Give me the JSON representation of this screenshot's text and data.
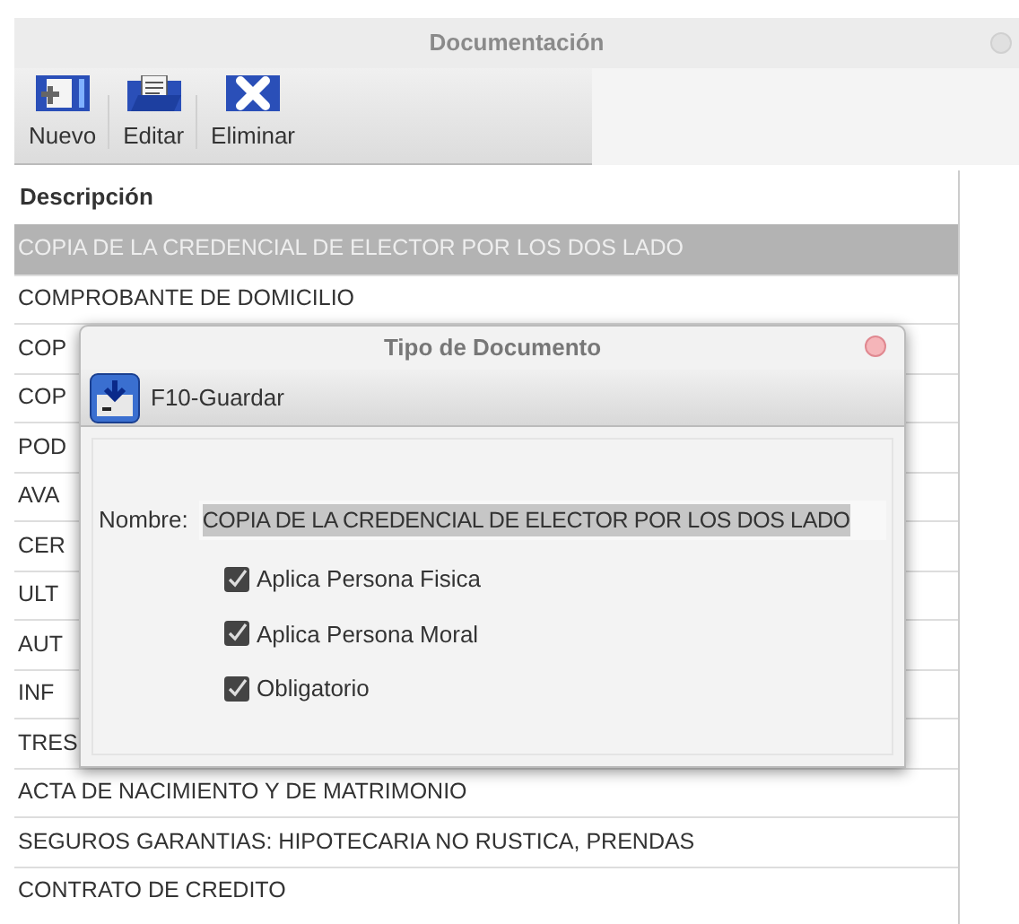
{
  "window": {
    "title": "Documentación"
  },
  "toolbar": [
    {
      "kind": "new",
      "label": "Nuevo"
    },
    {
      "kind": "edit",
      "label": "Editar"
    },
    {
      "kind": "delete",
      "label": "Eliminar"
    }
  ],
  "table": {
    "columns": [
      "Descripción"
    ],
    "rows": [
      {
        "text": "COPIA DE LA CREDENCIAL DE ELECTOR POR LOS DOS LADO",
        "selected": true
      },
      {
        "text": "COMPROBANTE DE DOMICILIO",
        "selected": false
      },
      {
        "text": "COP",
        "selected": false
      },
      {
        "text": "COP",
        "selected": false
      },
      {
        "text": "POD",
        "selected": false
      },
      {
        "text": "AVA",
        "selected": false
      },
      {
        "text": "CER",
        "selected": false
      },
      {
        "text": "ULT",
        "selected": false
      },
      {
        "text": "AUT",
        "selected": false
      },
      {
        "text": "INF",
        "selected": false
      },
      {
        "text": "TRES",
        "selected": false
      },
      {
        "text": "ACTA DE NACIMIENTO Y DE MATRIMONIO",
        "selected": false
      },
      {
        "text": "SEGUROS GARANTIAS: HIPOTECARIA NO RUSTICA, PRENDAS",
        "selected": false
      },
      {
        "text": "CONTRATO DE CREDITO",
        "selected": false
      }
    ]
  },
  "dialog": {
    "title": "Tipo de Documento",
    "save_button": "F10-Guardar",
    "name_label": "Nombre:",
    "name_value": "COPIA DE LA CREDENCIAL DE ELECTOR POR LOS DOS LADO",
    "checkboxes": [
      {
        "label": "Aplica Persona Fisica",
        "checked": true
      },
      {
        "label": "Aplica Persona Moral",
        "checked": true
      },
      {
        "label": "Obligatorio",
        "checked": true
      }
    ]
  }
}
